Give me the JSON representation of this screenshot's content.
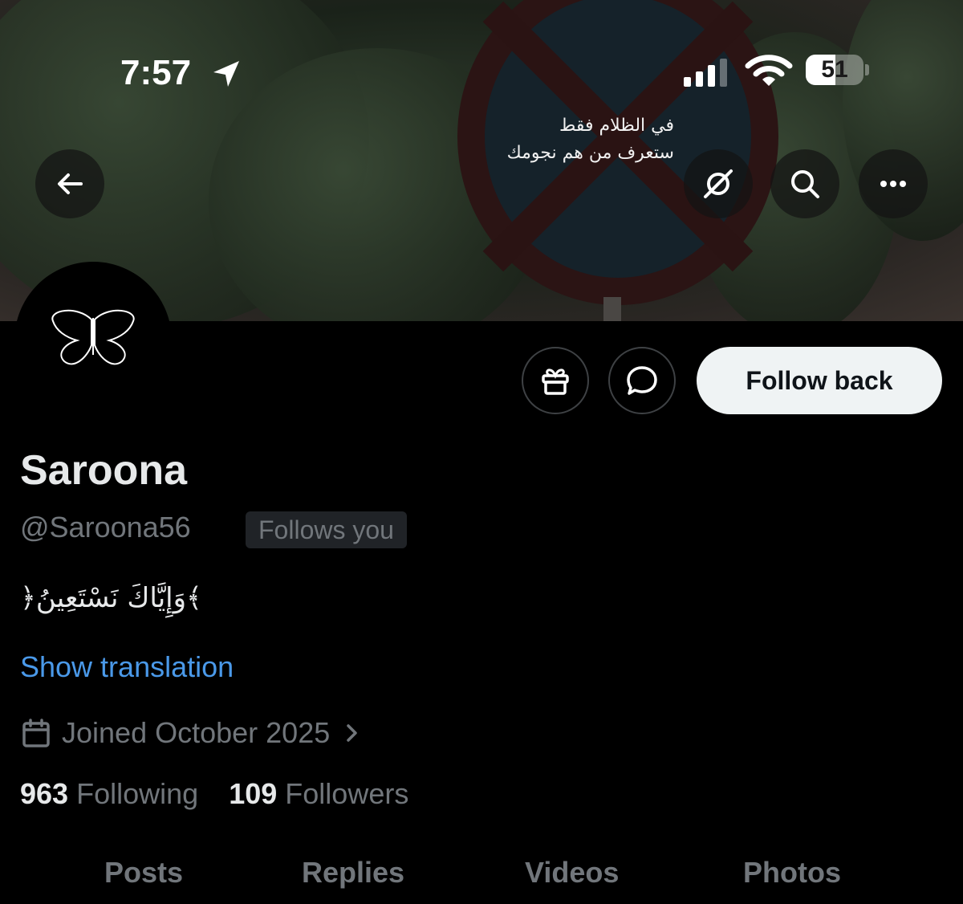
{
  "status_bar": {
    "time": "7:57",
    "battery": "51",
    "battery_level": 0.51
  },
  "banner": {
    "caption_line1": "في الظلام فقط",
    "caption_line2": "ستعرف من هم نجومك"
  },
  "header_icons": {
    "back": "arrow-left-icon",
    "grok": "grok-icon",
    "search": "search-icon",
    "more": "more-icon"
  },
  "actions": {
    "gift": "gift-icon",
    "message": "message-icon",
    "follow_label": "Follow back"
  },
  "profile": {
    "name": "Saroona",
    "handle": "@Saroona56",
    "follows_you": "Follows you",
    "bio": "﴿وَإِيَّاكَ نَسْتَعِينُ﴾",
    "translate": "Show translation",
    "joined": "Joined October 2025",
    "following_count": "963",
    "following_label": "Following",
    "followers_count": "109",
    "followers_label": "Followers"
  },
  "tabs": [
    "Posts",
    "Replies",
    "Videos",
    "Photos"
  ],
  "colors": {
    "background": "#000000",
    "text_primary": "#e7e9ea",
    "text_secondary": "#71767b",
    "link": "#4a99e9",
    "follow_button_bg": "#eff3f4"
  }
}
